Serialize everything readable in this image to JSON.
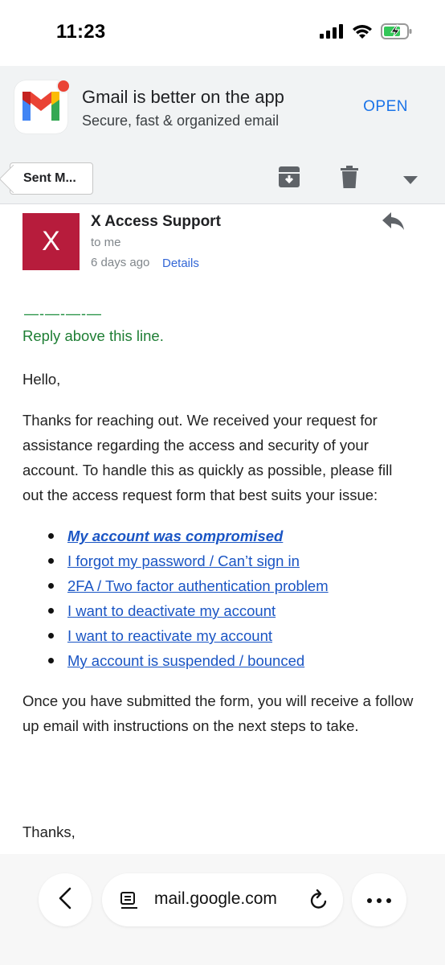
{
  "status_bar": {
    "time": "11:23"
  },
  "app_banner": {
    "title": "Gmail is better on the app",
    "subtitle": "Secure, fast & organized email",
    "open_label": "OPEN"
  },
  "toolbar": {
    "back_label": "Sent M...",
    "icons": [
      "archive-icon",
      "trash-icon",
      "dropdown-caret-icon"
    ]
  },
  "email": {
    "avatar_letter": "X",
    "avatar_color": "#b71c3c",
    "sender": "X Access Support",
    "recipient": "to me",
    "date": "6 days ago",
    "details_label": "Details",
    "divider": "—-—-—-—",
    "reply_above": "Reply above this line.",
    "greeting": "Hello,",
    "paragraph1": "Thanks for reaching out. We received your request for assistance regarding the access and security of your account. To handle this as quickly as possible, please fill out the access request form that best suits your issue:",
    "links": [
      "My account was compromised",
      "I forgot my password / Can’t sign in",
      "2FA / Two factor authentication problem",
      "I want to deactivate my account",
      "I want to reactivate my account",
      "My account is suspended / bounced"
    ],
    "paragraph2": "Once you have submitted the form, you will receive a follow up email with instructions on the next steps to take.",
    "signoff": "Thanks,"
  },
  "browser": {
    "url": "mail.google.com"
  },
  "colors": {
    "accent_blue": "#1a73e8",
    "link_blue": "#1a55c4",
    "green": "#1e8e3e"
  }
}
